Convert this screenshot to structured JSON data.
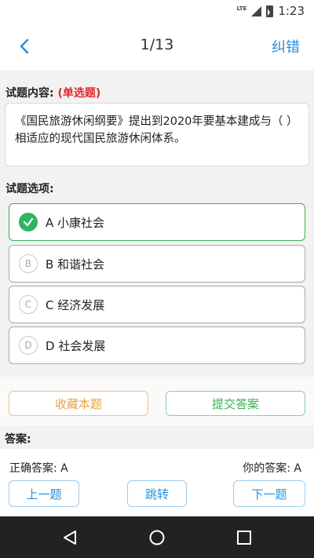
{
  "status_bar": {
    "network": "LTE",
    "time": "1:23"
  },
  "header": {
    "title": "1/13",
    "report_label": "纠错"
  },
  "question": {
    "label": "试题内容:",
    "type": "(单选题)",
    "text": "《国民旅游休闲纲要》提出到2020年要基本建成与（    ）相适应的现代国民旅游休闲体系。"
  },
  "options_label": "试题选项:",
  "options": [
    {
      "letter": "A",
      "text": "A 小康社会",
      "selected": true
    },
    {
      "letter": "B",
      "text": "B 和谐社会",
      "selected": false
    },
    {
      "letter": "C",
      "text": "C 经济发展",
      "selected": false
    },
    {
      "letter": "D",
      "text": "D 社会发展",
      "selected": false
    }
  ],
  "actions": {
    "favorite": "收藏本题",
    "submit": "提交答案"
  },
  "answer": {
    "label": "答案:",
    "correct": "正确答案: A",
    "yours": "你的答案: A"
  },
  "nav": {
    "prev": "上一题",
    "jump": "跳转",
    "next": "下一题"
  },
  "colors": {
    "accent": "#2a8fd8",
    "correct": "#2fb55e",
    "warning": "#e0282d",
    "favorite": "#e8a33b"
  }
}
